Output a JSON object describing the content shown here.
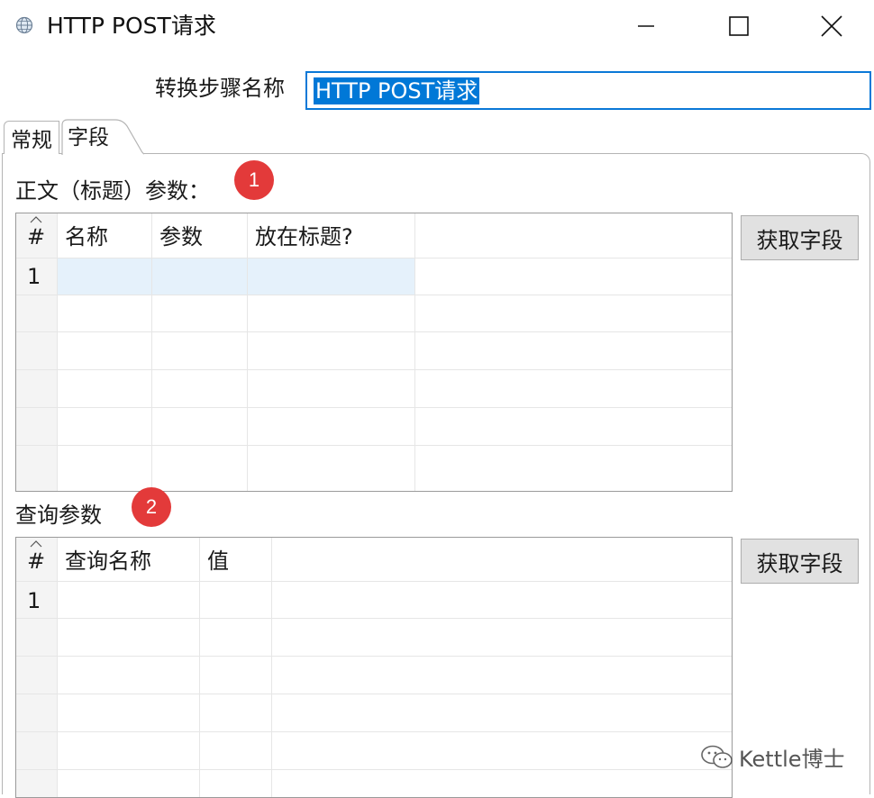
{
  "window": {
    "title": "HTTP POST请求",
    "icon": "globe-icon",
    "controls": [
      "minimize-icon",
      "maximize-icon",
      "close-icon"
    ]
  },
  "step_name": {
    "label": "转换步骤名称",
    "value": "HTTP POST请求"
  },
  "tabs": [
    {
      "label": "常规",
      "active": false
    },
    {
      "label": "字段",
      "active": true
    }
  ],
  "body_params": {
    "label": "正文（标题）参数：",
    "badge": "1",
    "columns": [
      "#",
      "名称",
      "参数",
      "放在标题?"
    ],
    "rows": [
      {
        "index": "1",
        "cells": [
          "",
          "",
          ""
        ]
      }
    ],
    "get_fields_button": "获取字段"
  },
  "query_params": {
    "label": "查询参数",
    "badge": "2",
    "columns": [
      "#",
      "查询名称",
      "值"
    ],
    "rows": [
      {
        "index": "1",
        "cells": [
          "",
          ""
        ]
      }
    ],
    "get_fields_button": "获取字段"
  },
  "watermark": "Kettle博士",
  "colors": {
    "accent": "#0078d7",
    "badge": "#e33a3a",
    "selected_row": "#e5f1fb"
  }
}
